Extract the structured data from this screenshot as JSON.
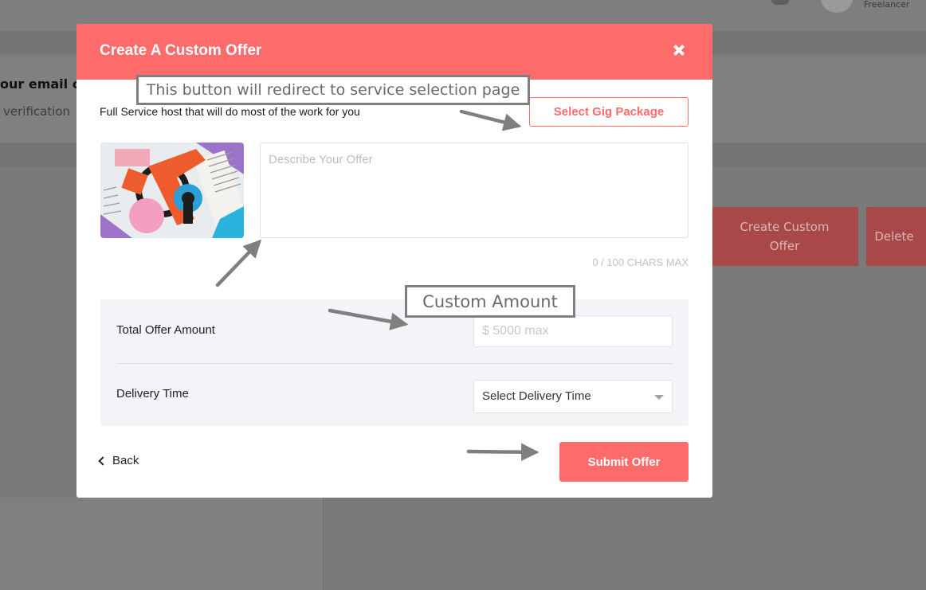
{
  "background": {
    "user_role": "Freelancer",
    "verify_title": "our email c",
    "verify_subtitle": "verification",
    "create_offer_label": "Create Custom Offer",
    "delete_label": "Delete"
  },
  "modal": {
    "title": "Create A Custom Offer",
    "service_description": "Full Service host that will do most of the work for you",
    "gig_button_label": "Select Gig Package",
    "offer_placeholder": "Describe Your Offer",
    "char_count": "0 / 100 CHARS MAX",
    "amount_label": "Total Offer Amount",
    "amount_placeholder": "$ 5000 max",
    "delivery_label": "Delivery Time",
    "delivery_value": "Select Delivery Time",
    "back_label": "Back",
    "submit_label": "Submit Offer"
  },
  "annotations": {
    "redirect_note": "This button will redirect to service selection page",
    "amount_note": "Custom Amount"
  },
  "colors": {
    "accent": "#fd6b6b",
    "annotation_gray": "#7f7f7f"
  },
  "icons": {
    "close": "close-icon",
    "back": "chevron-left-icon",
    "select": "chevron-down-icon"
  }
}
